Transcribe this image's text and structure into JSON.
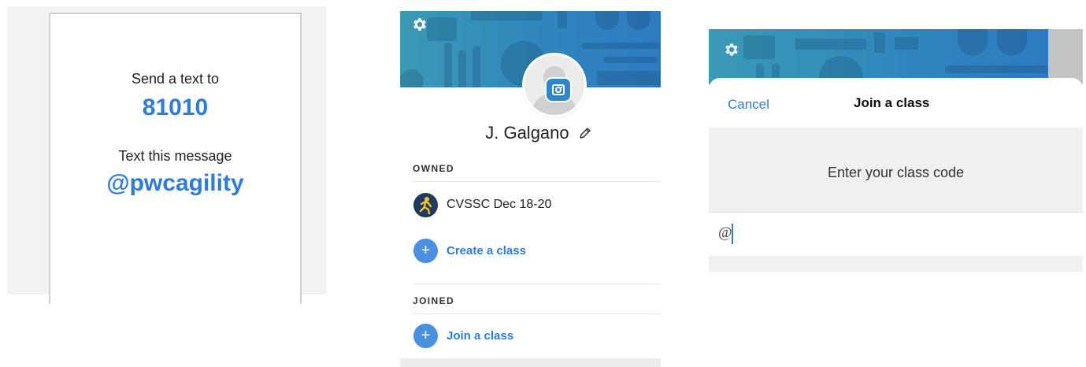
{
  "panel_text_to_join": {
    "line1": "Send a text to",
    "number": "81010",
    "line2": "Text this message",
    "code": "@pwcagility"
  },
  "panel_profile": {
    "settings_icon": "gear-icon",
    "camera_icon": "camera-icon",
    "edit_icon": "pencil-icon",
    "user_name": "J. Galgano",
    "owned_header": "OWNED",
    "owned_classes": [
      {
        "name": "CVSSC Dec 18-20",
        "icon": "runner-avatar"
      }
    ],
    "create_class_label": "Create a class",
    "joined_header": "JOINED",
    "join_class_label": "Join a class"
  },
  "panel_join_modal": {
    "settings_icon": "gear-icon",
    "cancel_label": "Cancel",
    "title": "Join a class",
    "prompt": "Enter your class code",
    "input_value": "@"
  },
  "colors": {
    "accent_blue": "#2f7bd9",
    "banner_teal": "#3a9ab6",
    "banner_blue": "#2e7ac2"
  }
}
